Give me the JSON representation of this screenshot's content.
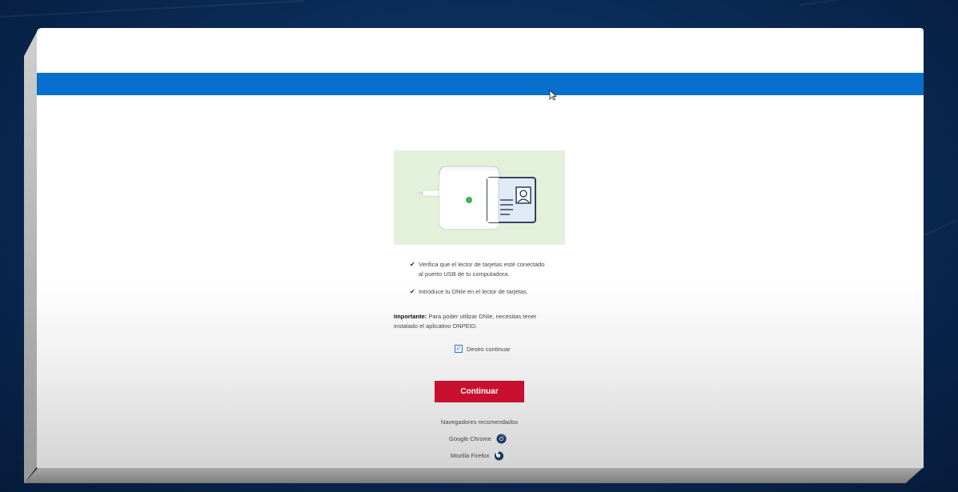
{
  "topbar": {
    "color": "#0870cc"
  },
  "illustration": {
    "description_icons": [
      "card-reader-icon",
      "id-card-icon"
    ]
  },
  "instructions": [
    {
      "line1": "Verifica que el lector de tarjetas esté conectado",
      "line2": "al puerto USB de tu computadora."
    },
    {
      "line1": "Introduce tu DNIe en el lector de tarjetas.",
      "line2": ""
    }
  ],
  "important": {
    "label": "Importante:",
    "text": " Para poder utilizar DNIe, necesitas tener instalado el aplicativo ONPEID."
  },
  "consent": {
    "checked": true,
    "label": "Deseo continuar"
  },
  "continue_button": {
    "label": "Continuar",
    "color": "#c8102e"
  },
  "browsers": {
    "title": "Navegadores recomendados",
    "items": [
      {
        "label": "Google Chrome",
        "icon": "chrome-icon"
      },
      {
        "label": "Mozilla Firefox",
        "icon": "firefox-icon"
      }
    ]
  }
}
